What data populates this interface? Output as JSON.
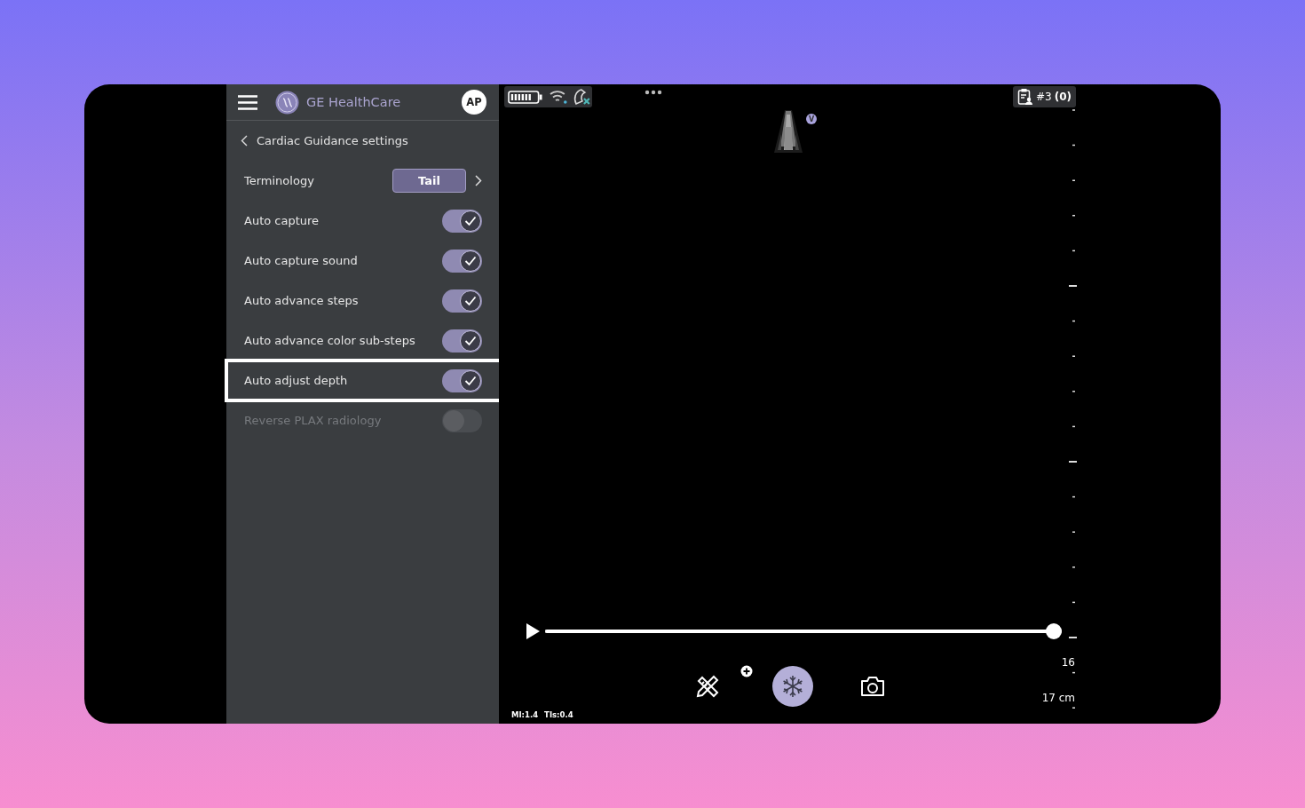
{
  "header": {
    "brand": "GE HealthCare",
    "avatar": "AP"
  },
  "nav": {
    "back_title": "Cardiac Guidance settings"
  },
  "settings": [
    {
      "kind": "select",
      "label": "Terminology",
      "value": "Tail"
    },
    {
      "kind": "toggle",
      "label": "Auto capture",
      "on": true,
      "disabled": false,
      "highlighted": false
    },
    {
      "kind": "toggle",
      "label": "Auto capture sound",
      "on": true,
      "disabled": false,
      "highlighted": false
    },
    {
      "kind": "toggle",
      "label": "Auto advance steps",
      "on": true,
      "disabled": false,
      "highlighted": false
    },
    {
      "kind": "toggle",
      "label": "Auto advance color sub-steps",
      "on": true,
      "disabled": false,
      "highlighted": false
    },
    {
      "kind": "toggle",
      "label": "Auto adjust depth",
      "on": true,
      "disabled": false,
      "highlighted": true
    },
    {
      "kind": "toggle",
      "label": "Reverse PLAX radiology",
      "on": false,
      "disabled": true,
      "highlighted": false
    }
  ],
  "viewer": {
    "study": "#3",
    "study_count": "(0)",
    "badge": "V",
    "cine": {
      "level": 1
    },
    "depth_mark": "16",
    "depth": "17 cm",
    "indices": [
      "MI:1.4",
      "TIs:0.4"
    ]
  }
}
